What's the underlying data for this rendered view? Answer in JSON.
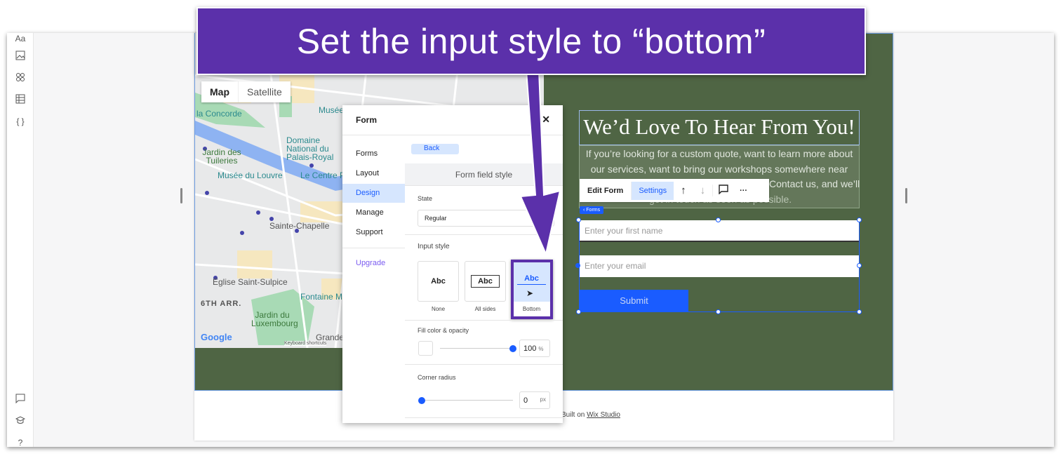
{
  "banner": {
    "text": "Set the input style to “bottom”"
  },
  "left_toolbar": {
    "top_icons": [
      "text-icon",
      "image-icon",
      "apps-icon",
      "table-icon",
      "code-braces-icon"
    ],
    "bottom_icons": [
      "chat-icon",
      "graduation-cap-icon",
      "help-icon"
    ]
  },
  "map": {
    "type_buttons": [
      "Map",
      "Satellite"
    ],
    "labels": [
      "la Concorde",
      "Musée",
      "Domaine National du Palais-Royal",
      "Jardin des Tuileries",
      "Musée du Louvre",
      "Le Centre Po",
      "Sainte-Chapelle",
      "Église Saint-Sulpice",
      "6TH ARR.",
      "Fontaine Mé",
      "Jardin du Luxembourg",
      "Grande"
    ],
    "attribution": "Keyboard shortcuts",
    "google": "Google"
  },
  "panel": {
    "title": "Form",
    "close": "✕",
    "nav": [
      "Forms",
      "Layout",
      "Design",
      "Manage",
      "Support"
    ],
    "nav_active": "Design",
    "upgrade": "Upgrade",
    "back": "Back",
    "section_title": "Form field style",
    "state_label": "State",
    "state_value": "Regular",
    "input_style_label": "Input style",
    "input_styles": [
      {
        "sample": "Abc",
        "caption": "None"
      },
      {
        "sample": "Abc",
        "caption": "All sides"
      },
      {
        "sample": "Abc",
        "caption": "Bottom"
      }
    ],
    "input_style_selected": "Bottom",
    "fill_label": "Fill color & opacity",
    "fill_opacity": "100",
    "fill_unit": "%",
    "radius_label": "Corner radius",
    "radius_value": "0",
    "radius_unit": "px"
  },
  "site": {
    "heading": "We’d Love To Hear From You!",
    "paragraph": "If you’re looking for a custom quote, want to learn more about our services, want to bring our workshops somewhere near you, or",
    "paragraph_line3": "Contact us, and we’ll",
    "paragraph_line4": "get in touch as soon as possible.",
    "toolbar": {
      "edit_form": "Edit Form",
      "settings": "Settings"
    },
    "forms_tag": "‹ Forms",
    "first_name_placeholder": "Enter your first name",
    "email_placeholder": "Enter your email",
    "submit": "Submit",
    "footer_prefix": "Built on",
    "footer_link": "Wix Studio"
  },
  "colors": {
    "banner": "#5b30aa",
    "section_bg": "#4f6544",
    "accent": "#1a5cff",
    "selected_bg": "#d6e6fe"
  }
}
